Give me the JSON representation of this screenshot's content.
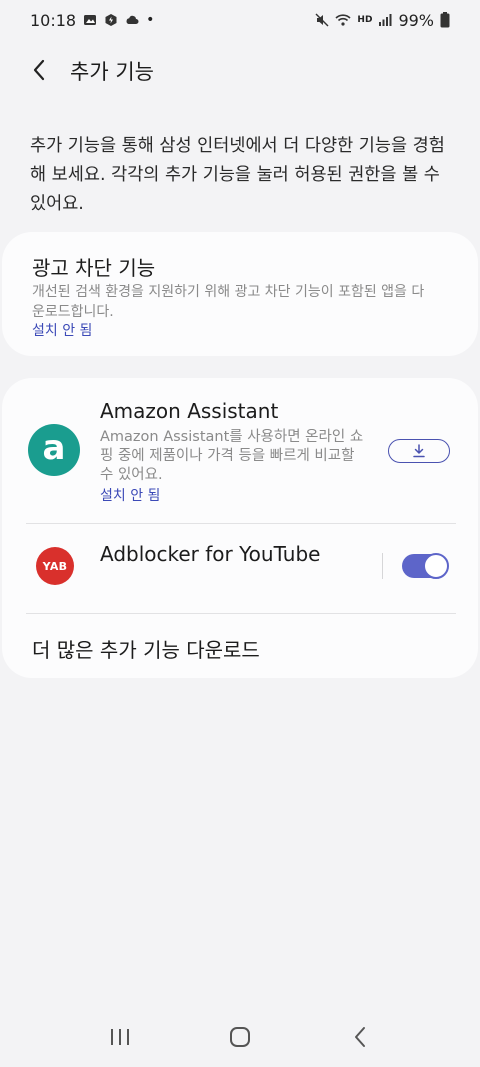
{
  "status_bar": {
    "time": "10:18",
    "battery": "99%",
    "hd_label": "HD"
  },
  "app_bar": {
    "title": "추가 기능"
  },
  "intro": {
    "text": "추가 기능을 통해 삼성 인터넷에서 더 다양한 기능을 경험해 보세요. 각각의 추가 기능을 눌러 허용된 권한을 볼 수 있어요."
  },
  "ad_block_card": {
    "title": "광고 차단 기능",
    "description": "개선된 검색 환경을 지원하기 위해 광고 차단 기능이 포함된 앱을 다운로드합니다.",
    "status": "설치 안 됨"
  },
  "extensions": {
    "amazon": {
      "logo_letter": "a",
      "title": "Amazon Assistant",
      "description": "Amazon Assistant를 사용하면 온라인 쇼핑 중에 제품이나 가격 등을 빠르게 비교할 수 있어요.",
      "status": "설치 안 됨"
    },
    "yab": {
      "logo_text": "YAB",
      "title": "Adblocker for YouTube",
      "enabled": true
    },
    "more_label": "더 많은 추가 기능 다운로드"
  },
  "colors": {
    "accent": "#5d65c9",
    "link": "#3c4ab7",
    "amazon_logo": "#1a9d8f",
    "yab_logo": "#d9302c",
    "background": "#f3f3f5"
  }
}
